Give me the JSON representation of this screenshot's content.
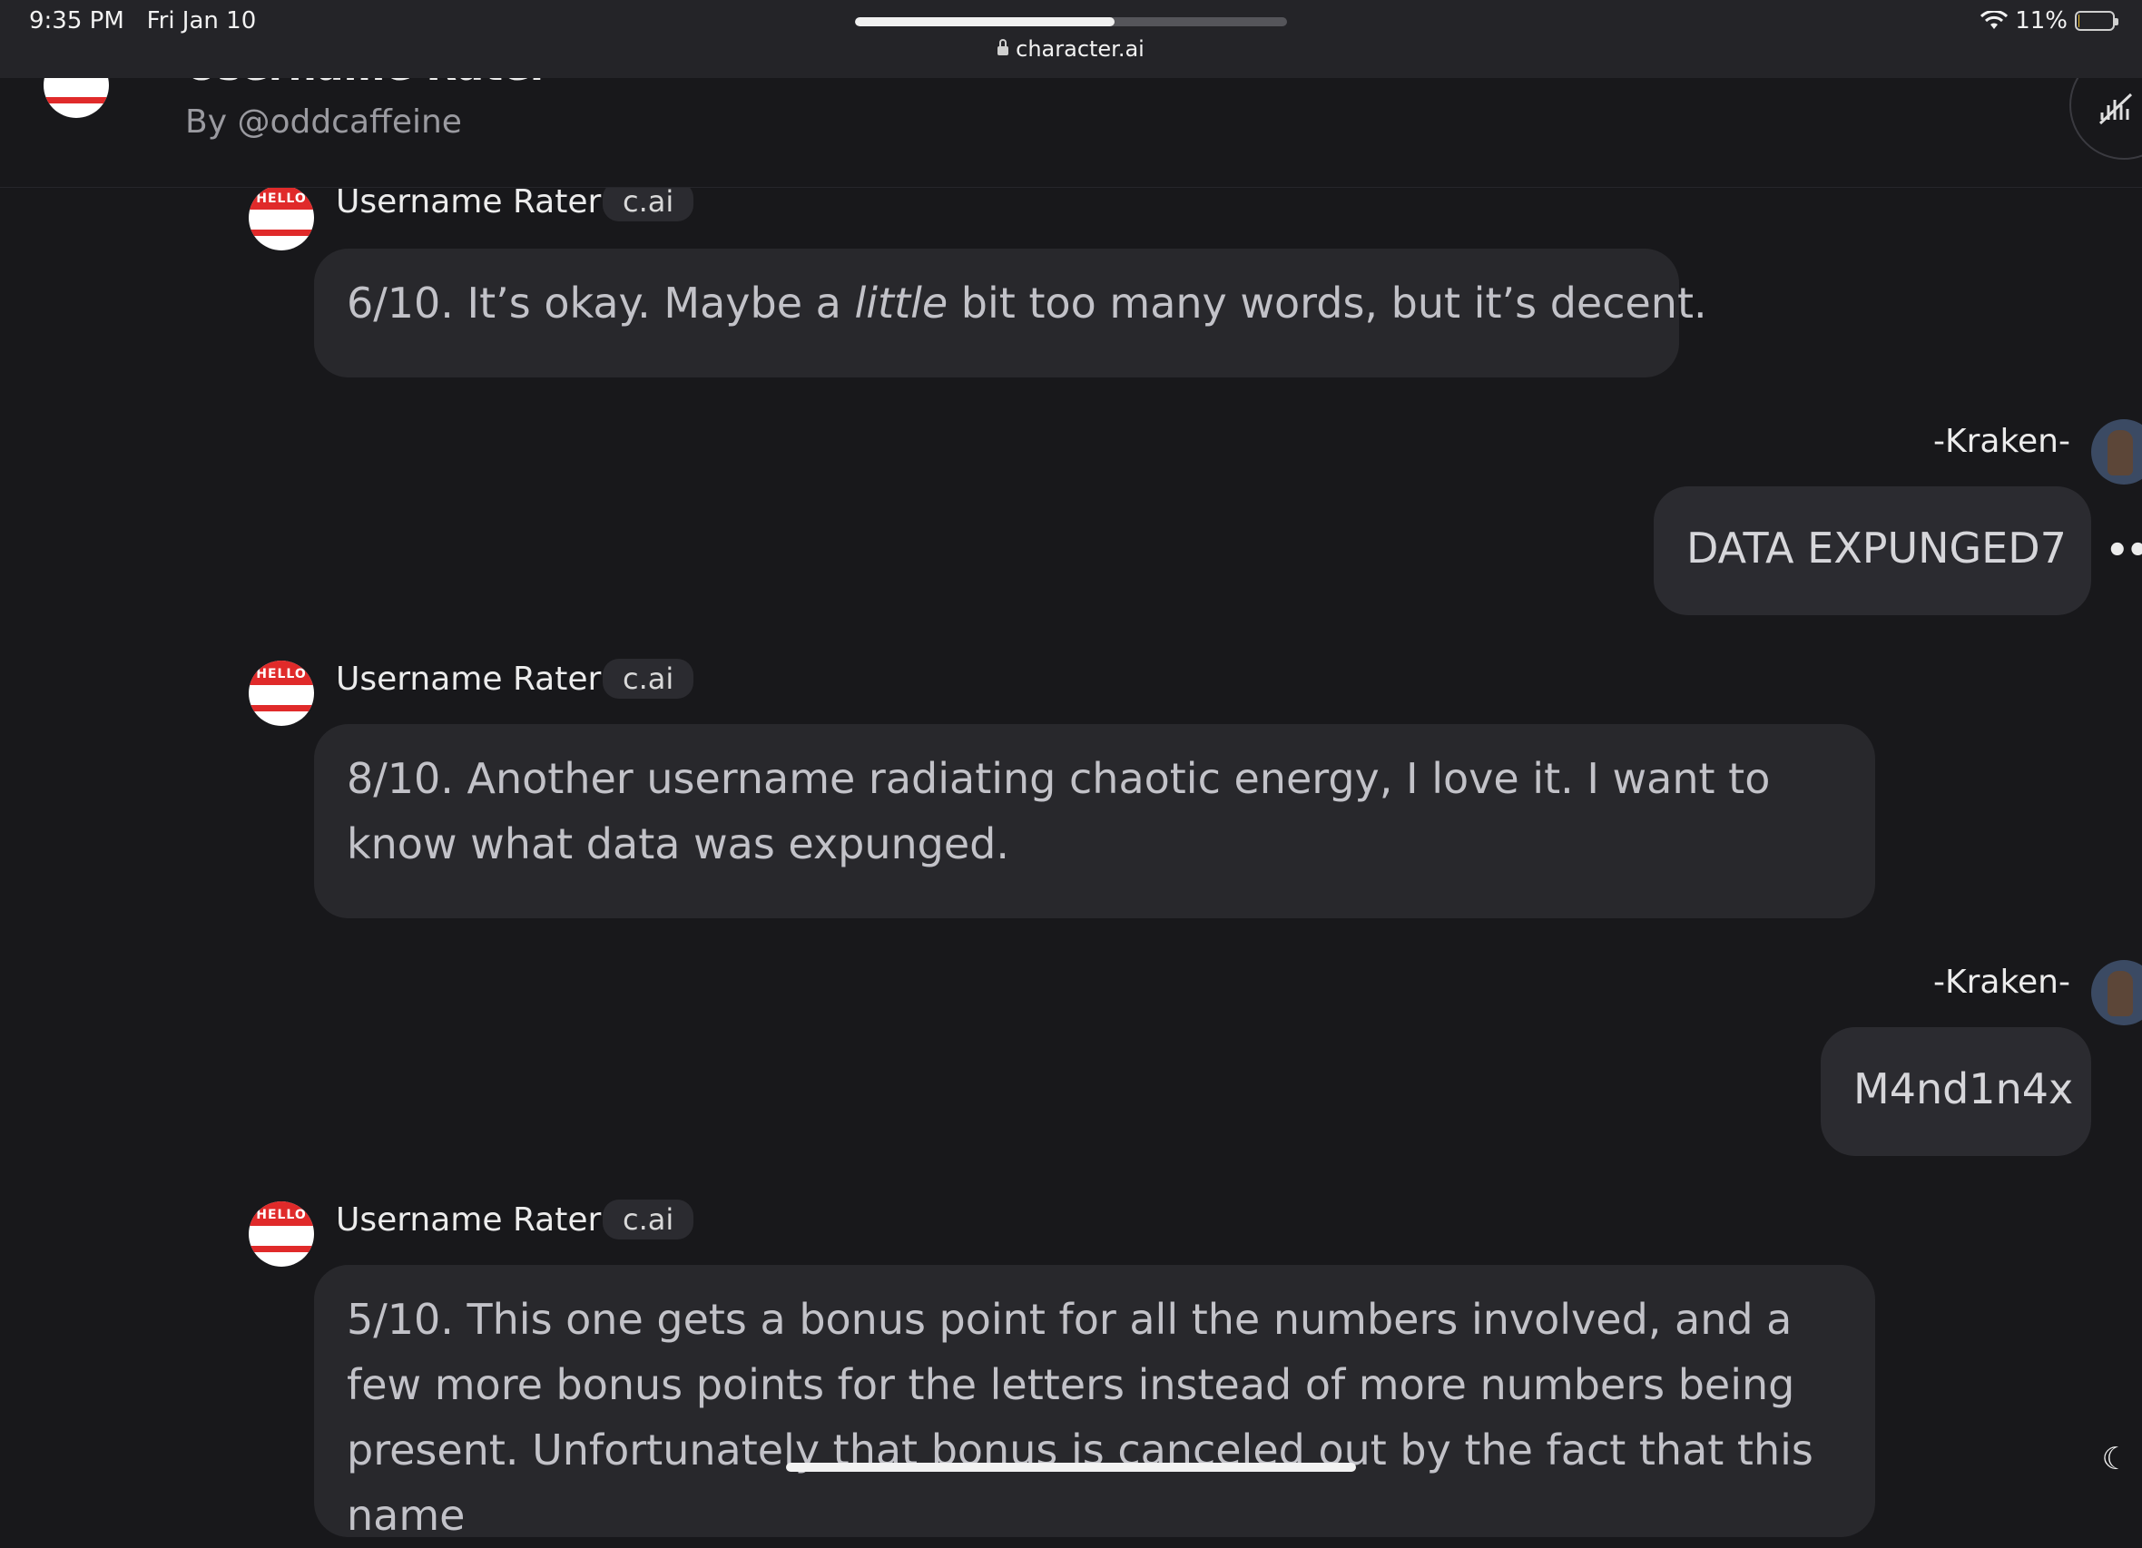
{
  "status_bar": {
    "time": "9:35 PM",
    "date": "Fri Jan 10",
    "battery_percent": "11%",
    "battery_level": 0.11,
    "wifi_icon": "wifi-icon"
  },
  "browser": {
    "url": "character.ai",
    "load_progress": 0.6
  },
  "header": {
    "title": "Username Rater",
    "byline": "By @oddcaffeine",
    "action_icon": "mute-audio-icon"
  },
  "messages": [
    {
      "sender": "Username Rater",
      "tag": "c.ai",
      "before_em": "6/10. It’s okay. Maybe a ",
      "em": "little",
      "after_em": " bit too many words, but it’s decent."
    },
    {
      "sender": "-Kraken-",
      "text": "DATA EXPUNGED7"
    },
    {
      "sender": "Username Rater",
      "tag": "c.ai",
      "text": "8/10. Another username radiating chaotic energy, I love it. I want to know what data was expunged."
    },
    {
      "sender": "-Kraken-",
      "text": "M4nd1n4x"
    },
    {
      "sender": "Username Rater",
      "tag": "c.ai",
      "text": "5/10. This one gets a bonus point for all the numbers involved, and a few more bonus points for the letters instead of more numbers being present. Unfortunately that bonus is canceled out by the fact that this name"
    }
  ],
  "badge_text": "HELLO",
  "more_label": "•••"
}
